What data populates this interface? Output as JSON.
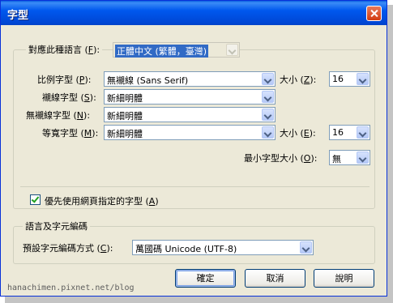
{
  "window": {
    "title": "字型"
  },
  "language_row": {
    "label": "對應此種語言",
    "key": "F",
    "value": "正體中文 (繁體，臺灣)"
  },
  "proportional": {
    "label": "比例字型",
    "key": "P",
    "value": "無襯線 (Sans Serif)",
    "size_label": "大小",
    "size_key": "Z",
    "size_value": "16"
  },
  "serif": {
    "label": "襯線字型",
    "key": "S",
    "value": "新細明體"
  },
  "sans_serif": {
    "label": "無襯線字型",
    "key": "N",
    "value": "新細明體"
  },
  "monospace": {
    "label": "等寬字型",
    "key": "M",
    "value": "新細明體",
    "size_label": "大小",
    "size_key": "E",
    "size_value": "16"
  },
  "min_size": {
    "label": "最小字型大小",
    "key": "O",
    "value": "無"
  },
  "allow_pages": {
    "label": "優先使用網頁指定的字型",
    "key": "A",
    "checked": true
  },
  "encoding_group": {
    "title": "語言及字元編碼",
    "label": "預設字元編碼方式",
    "key": "C",
    "value": "萬國碼 Unicode (UTF-8)"
  },
  "buttons": {
    "ok": "確定",
    "cancel": "取消",
    "help": "說明"
  },
  "watermark": "hanachimen.pixnet.net/blog"
}
